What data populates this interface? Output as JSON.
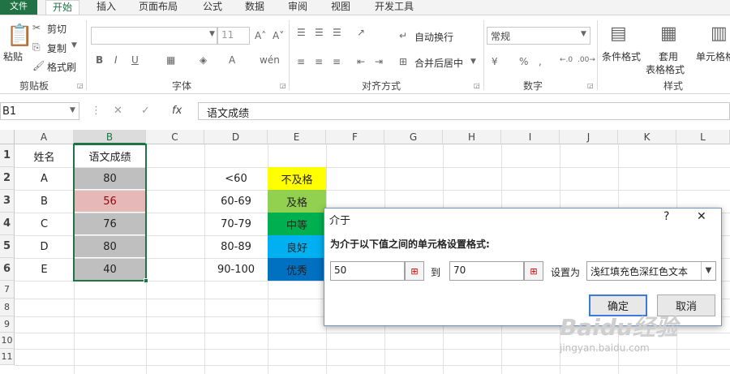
{
  "ribbon_tabs": [
    "文件",
    "开始",
    "插入",
    "页面布局",
    "公式",
    "数据",
    "审阅",
    "视图",
    "开发工具"
  ],
  "clipboard": {
    "paste": "粘贴",
    "cut": "剪切",
    "copy": "复制",
    "format_painter": "格式刷",
    "group": "剪贴板"
  },
  "font": {
    "size": "11",
    "group": "字体"
  },
  "alignment": {
    "wrap": "自动换行",
    "merge": "合并后居中",
    "group": "对齐方式"
  },
  "number": {
    "format": "常规",
    "group": "数字"
  },
  "styles": {
    "conditional": "条件格式",
    "table1": "套用",
    "table2": "表格格式",
    "cell": "单元格格",
    "group": "样式"
  },
  "formula_bar": {
    "name_box": "B1",
    "fx": "fx",
    "content": "语文成绩"
  },
  "columns": [
    "A",
    "B",
    "C",
    "D",
    "E",
    "F",
    "G",
    "H",
    "I",
    "J",
    "K",
    "L"
  ],
  "rows": [
    "1",
    "2",
    "3",
    "4",
    "5",
    "6",
    "7",
    "8",
    "9",
    "10",
    "11"
  ],
  "sheet": {
    "a": [
      "姓名",
      "A",
      "B",
      "C",
      "D",
      "E"
    ],
    "b": [
      "语文成绩",
      "80",
      "56",
      "76",
      "80",
      "40"
    ],
    "d": [
      "<60",
      "60-69",
      "70-79",
      "80-89",
      "90-100"
    ],
    "e": [
      "不及格",
      "及格",
      "中等",
      "良好",
      "优秀"
    ]
  },
  "colors": {
    "accent": "#217346",
    "e2": "#ffff00",
    "e3": "#92d050",
    "e4": "#00b050",
    "e5": "#00b0f0",
    "e6": "#0070c0",
    "highlight_fill": "#e6b8b7",
    "highlight_text": "#9c0006",
    "selection": "#bfbfbf"
  },
  "dialog": {
    "title": "介于",
    "help": "?",
    "close": "✕",
    "prompt": "为介于以下值之间的单元格设置格式:",
    "value1": "50",
    "to": "到",
    "value2": "70",
    "set_as": "设置为",
    "format": "浅红填充色深红色文本",
    "ok": "确定",
    "cancel": "取消"
  },
  "watermark": {
    "text": "Baidu经验",
    "url": "jingyan.baidu.com"
  }
}
